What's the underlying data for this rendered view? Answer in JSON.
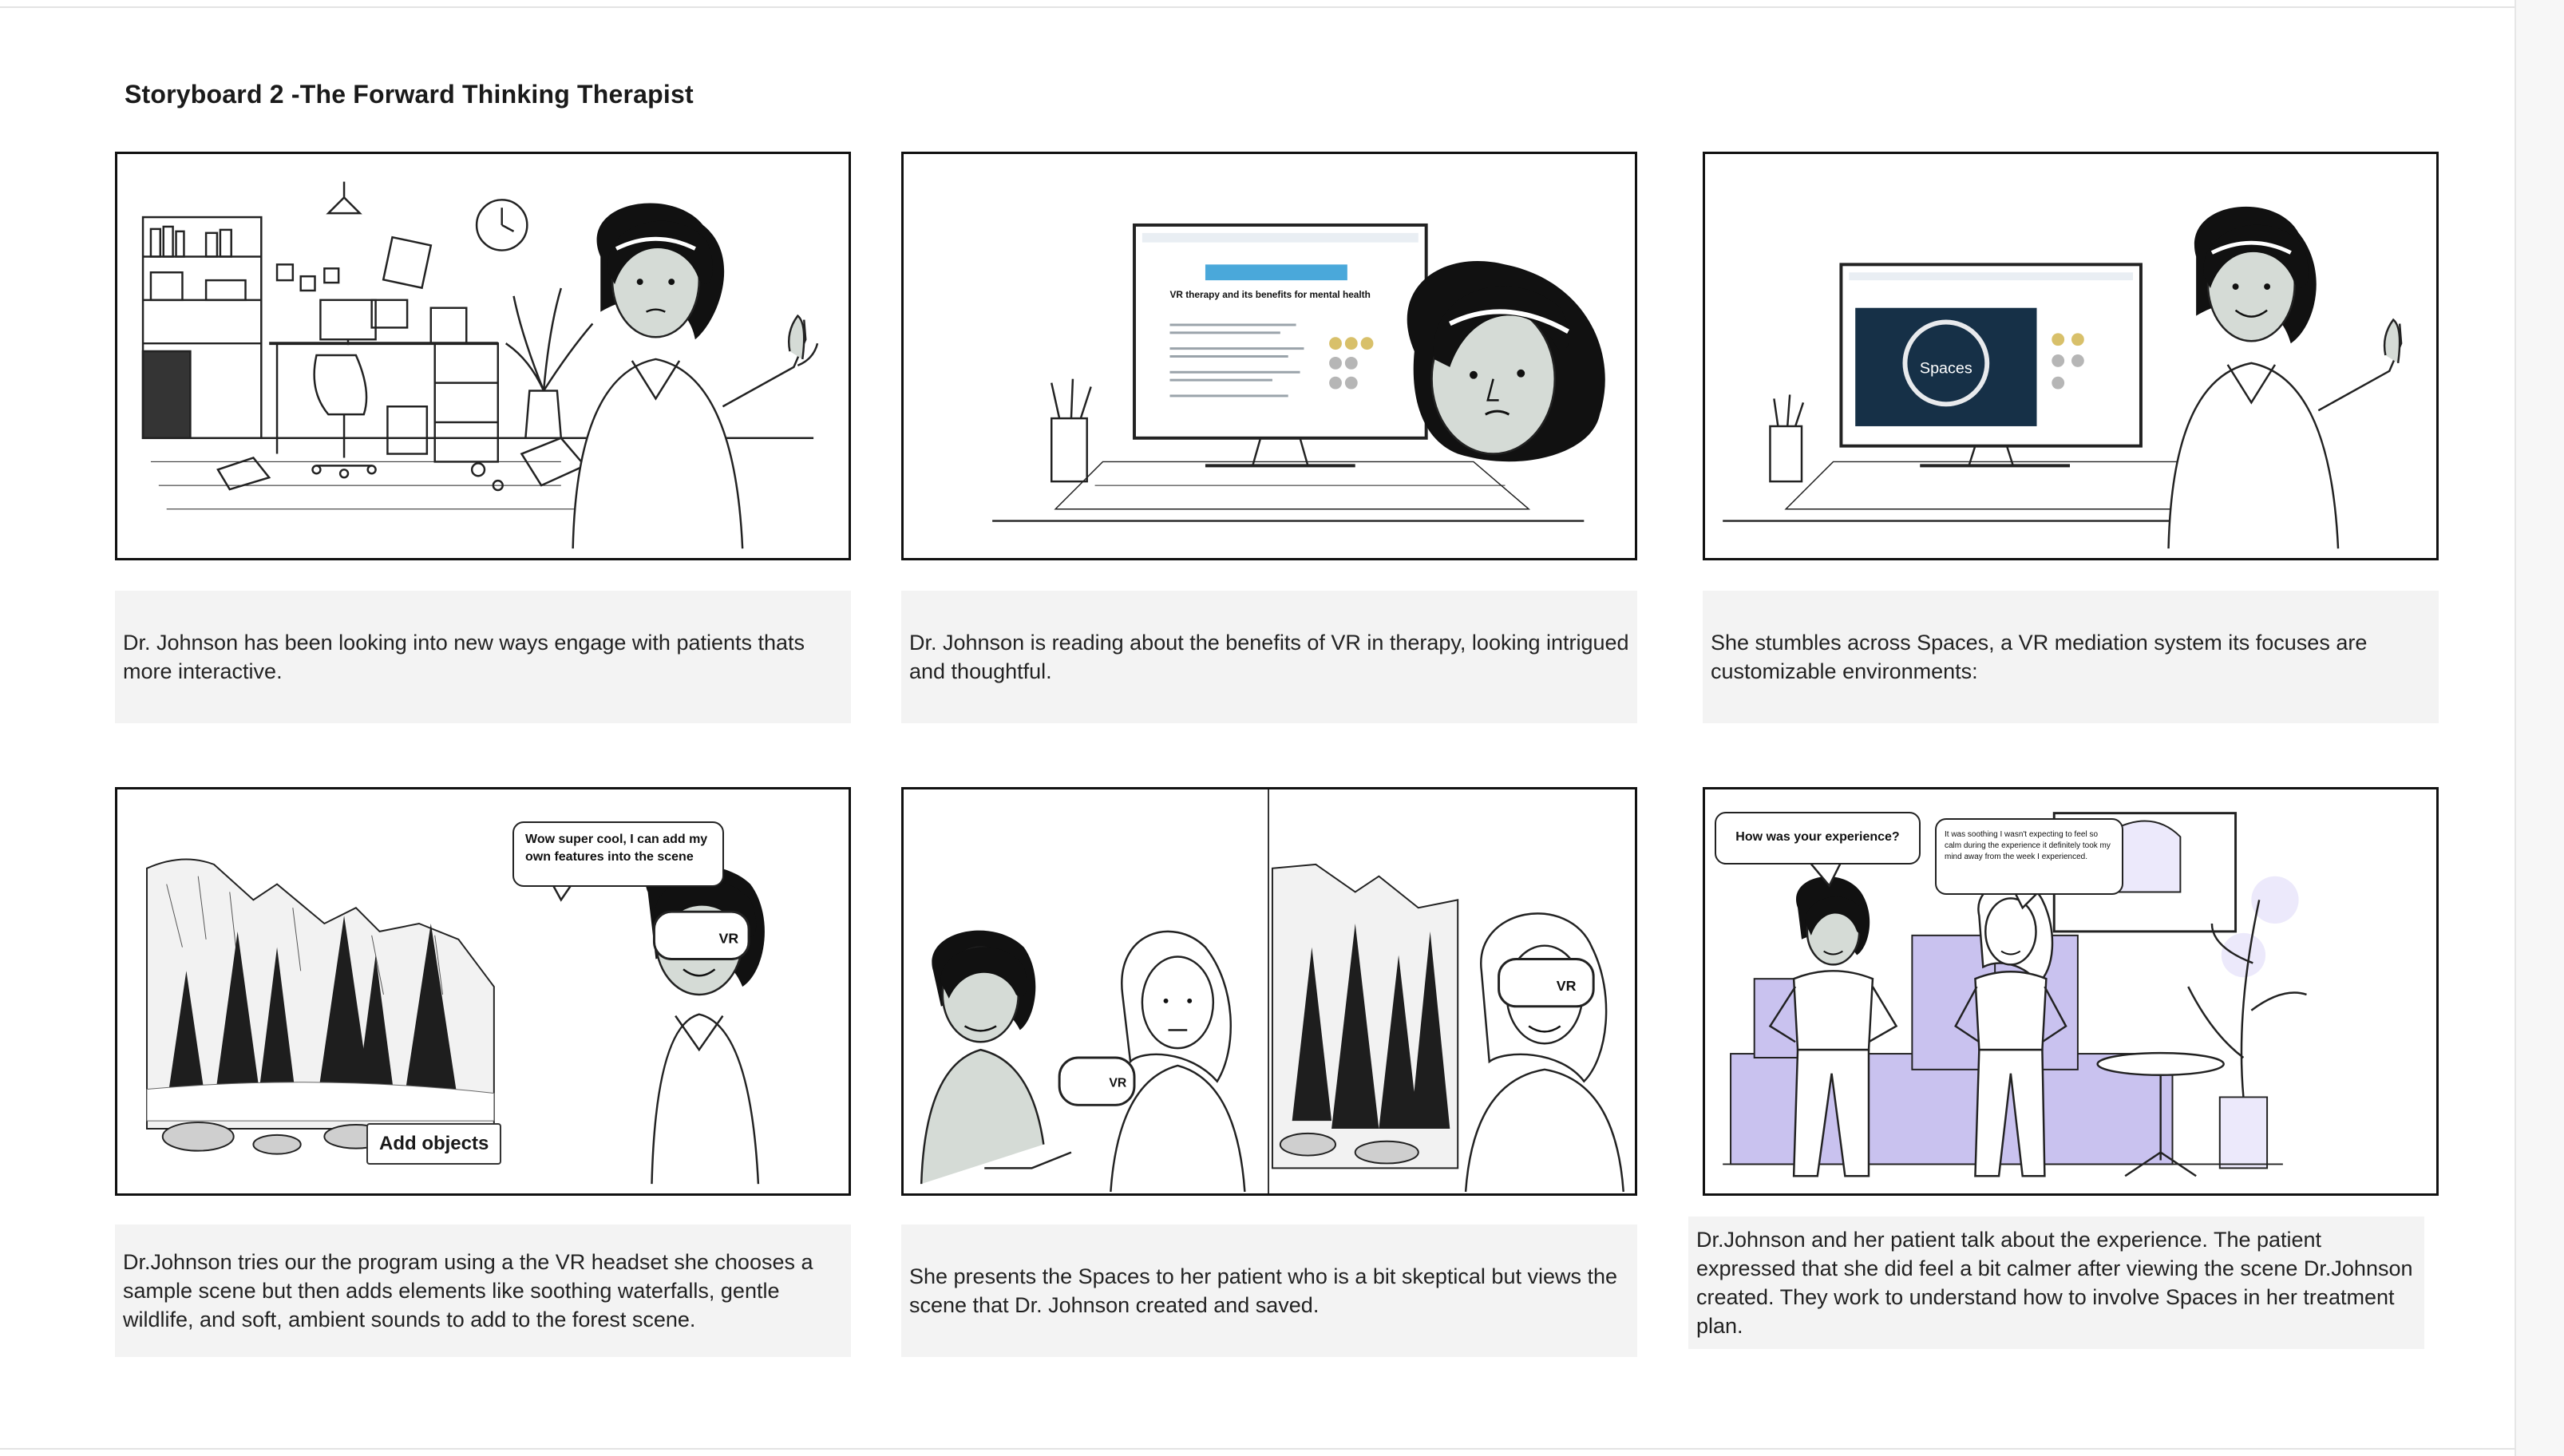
{
  "board": {
    "title": "Storyboard 2 -The Forward Thinking Therapist"
  },
  "panels": [
    {
      "caption": "Dr. Johnson has been looking into new ways engage with patients thats more interactive."
    },
    {
      "caption": "Dr. Johnson is reading about the benefits of VR in therapy, looking intrigued and thoughtful.",
      "screen_headline": "VR therapy and its benefits for mental health"
    },
    {
      "caption": "She stumbles across Spaces, a VR mediation system its focuses are customizable environments:",
      "logo_text": "Spaces"
    },
    {
      "caption": "Dr.Johnson tries our the program using a the VR headset she chooses a sample scene but then adds elements like soothing waterfalls, gentle wildlife, and soft, ambient sounds to add to the forest scene.",
      "speech": "Wow super cool, I can add my own features into the scene",
      "button": "Add objects",
      "headset_label": "VR"
    },
    {
      "caption": "She presents the Spaces  to her patient who is a bit skeptical but views the scene that Dr. Johnson created and saved.",
      "headset_label": "VR"
    },
    {
      "caption": "Dr.Johnson and her patient talk about the experience. The patient expressed that she did feel a bit calmer after viewing the scene Dr.Johnson created. They work to understand how to involve Spaces in her treatment plan.",
      "speech_left": "How was your experience?",
      "speech_right": "It was soothing I wasn't expecting to feel so calm during the experience it definitely took my mind away from the week I experienced."
    }
  ],
  "colors": {
    "skin": "#d5dbd6",
    "hair": "#111111",
    "lavender": "#c9c2ef",
    "screen_blue": "#163047"
  }
}
